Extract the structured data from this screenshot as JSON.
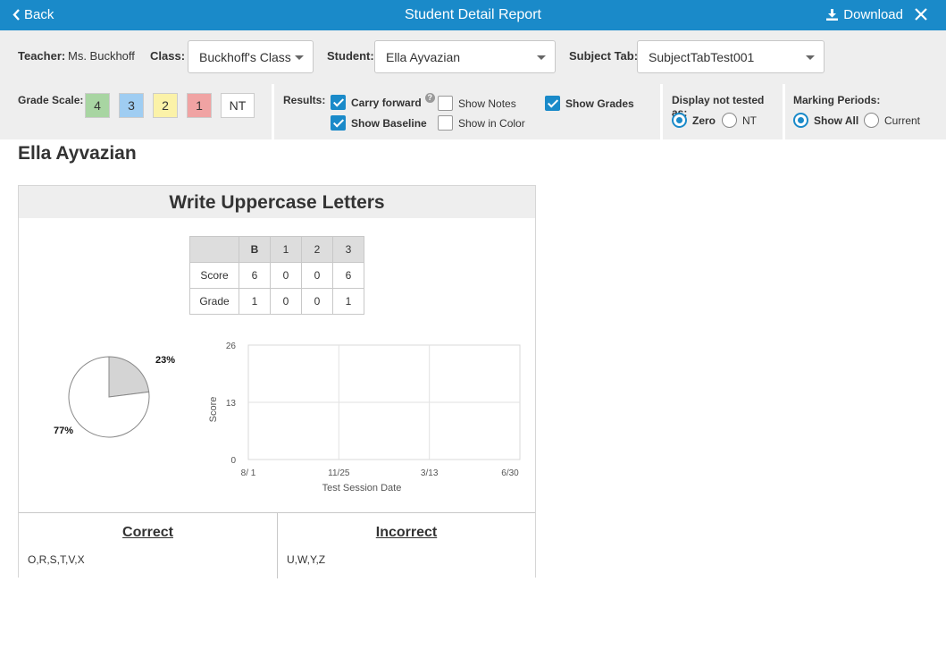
{
  "titlebar": {
    "back_label": "Back",
    "title": "Student Detail Report",
    "download_label": "Download"
  },
  "filters": {
    "teacher_label": "Teacher:",
    "teacher_value": "Ms. Buckhoff",
    "class_label": "Class:",
    "class_value": "Buckhoff's Class",
    "student_label": "Student:",
    "student_value": "Ella Ayvazian",
    "subject_tab_label": "Subject Tab:",
    "subject_tab_value": "SubjectTabTest001"
  },
  "grade_scale": {
    "label": "Grade Scale:",
    "swatches": [
      {
        "text": "4",
        "color": "#a8d5a2"
      },
      {
        "text": "3",
        "color": "#9fcdf2"
      },
      {
        "text": "2",
        "color": "#fbf2a8"
      },
      {
        "text": "1",
        "color": "#f0a3a3"
      },
      {
        "text": "NT",
        "color": "#ffffff"
      }
    ]
  },
  "results": {
    "label": "Results:",
    "carry_forward": {
      "label": "Carry forward",
      "checked": true
    },
    "show_baseline": {
      "label": "Show Baseline",
      "checked": true
    },
    "show_notes": {
      "label": "Show Notes",
      "checked": false
    },
    "show_in_color": {
      "label": "Show in Color",
      "checked": false
    },
    "show_grades": {
      "label": "Show Grades",
      "checked": true
    }
  },
  "display_not_tested": {
    "label": "Display not tested as:",
    "options": [
      {
        "label": "Zero",
        "selected": true
      },
      {
        "label": "NT",
        "selected": false
      }
    ]
  },
  "marking_periods": {
    "label": "Marking Periods:",
    "options": [
      {
        "label": "Show All",
        "selected": true
      },
      {
        "label": "Current",
        "selected": false
      }
    ]
  },
  "student_name": "Ella Ayvazian",
  "card": {
    "title": "Write Uppercase Letters",
    "table": {
      "columns": [
        "B",
        "1",
        "2",
        "3"
      ],
      "rows": [
        {
          "label": "Score",
          "values": [
            "6",
            "0",
            "0",
            "6"
          ]
        },
        {
          "label": "Grade",
          "values": [
            "1",
            "0",
            "0",
            "1"
          ]
        }
      ]
    },
    "correct": {
      "heading": "Correct",
      "letters": "O,R,S,T,V,X"
    },
    "incorrect": {
      "heading": "Incorrect",
      "letters": "U,W,Y,Z"
    }
  },
  "chart_data": [
    {
      "type": "pie",
      "slices": [
        {
          "label": "23%",
          "value": 23,
          "color": "#d4d4d4"
        },
        {
          "label": "77%",
          "value": 77,
          "color": "#ffffff"
        }
      ]
    },
    {
      "type": "line",
      "xlabel": "Test Session Date",
      "ylabel": "Score",
      "x_ticks": [
        "8/ 1",
        "11/25",
        "3/13",
        "6/30"
      ],
      "y_ticks": [
        "0",
        "13",
        "26"
      ],
      "ylim": [
        0,
        26
      ],
      "grid": true,
      "series": []
    }
  ]
}
